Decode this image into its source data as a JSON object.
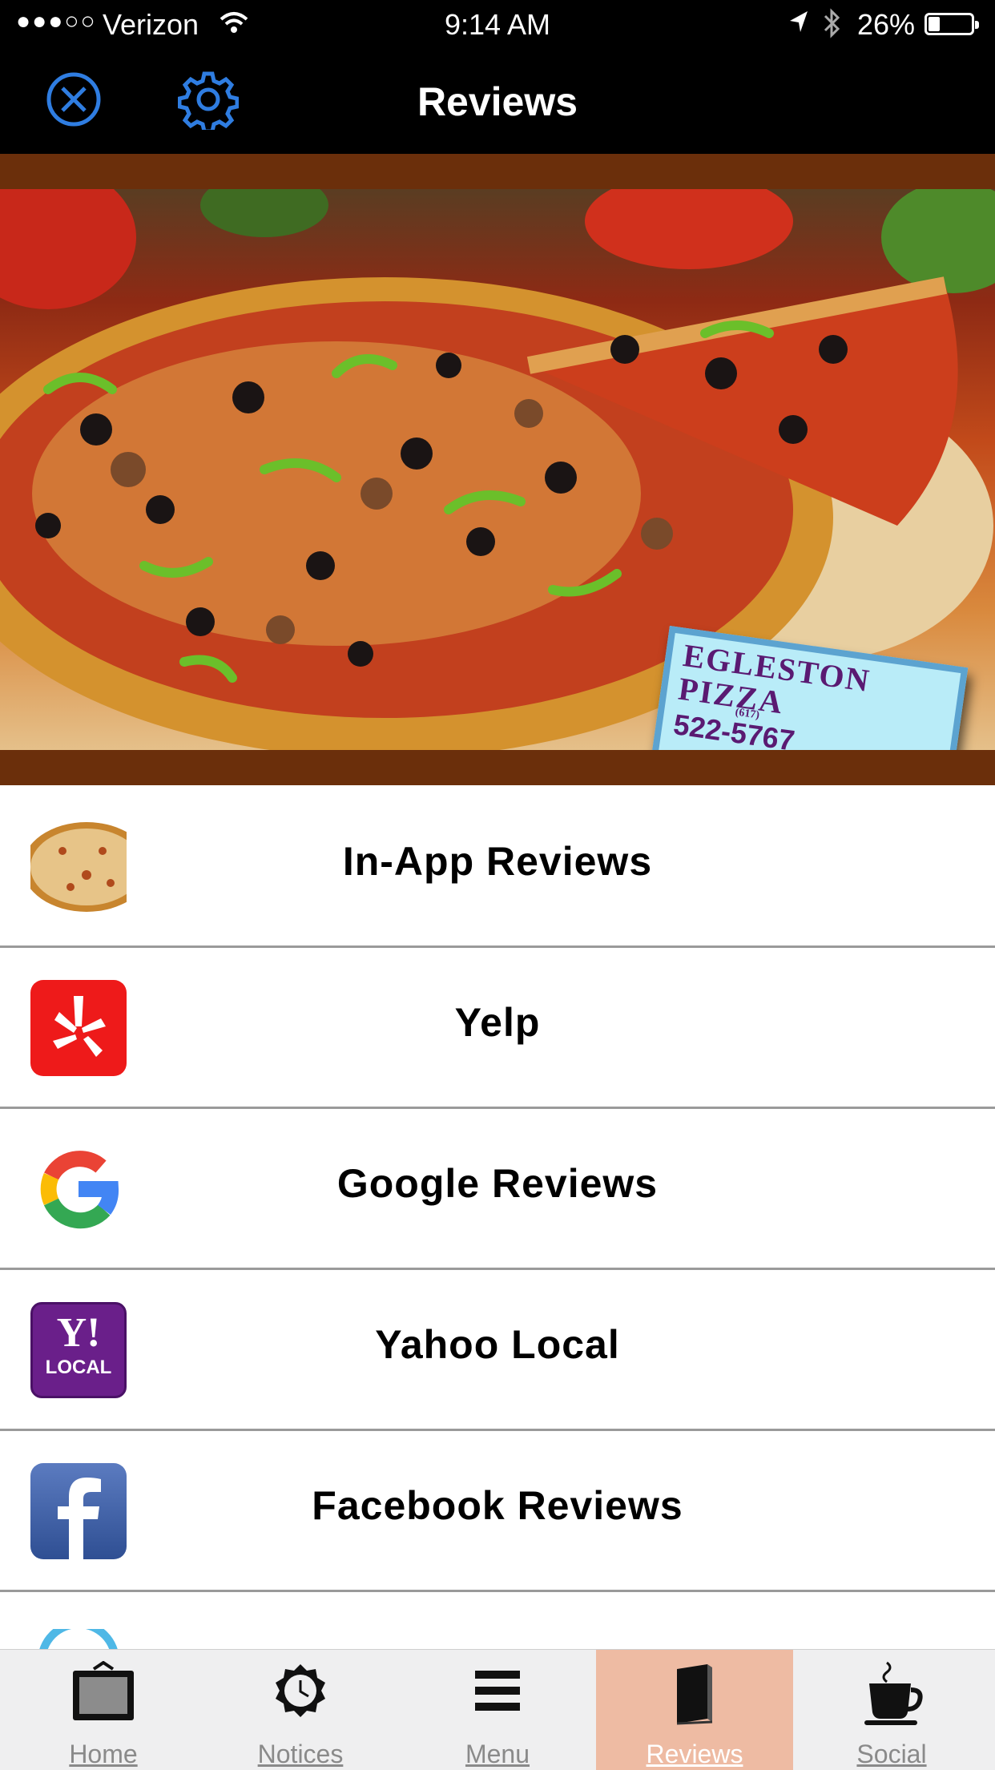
{
  "status_bar": {
    "carrier": "Verizon",
    "signal_dots": "●●●○○",
    "time": "9:14 AM",
    "battery_percent": "26%",
    "battery_level": 0.26
  },
  "nav": {
    "title": "Reviews",
    "close_icon": "close-circle-icon",
    "settings_icon": "gear-icon"
  },
  "hero": {
    "sign_line1": "EGLESTON",
    "sign_line2": "PIZZA",
    "sign_area_code": "(617)",
    "sign_phone": "522-5767"
  },
  "review_sources": [
    {
      "label": "In-App Reviews",
      "icon": "pizza-icon"
    },
    {
      "label": "Yelp",
      "icon": "yelp-icon"
    },
    {
      "label": "Google Reviews",
      "icon": "google-icon"
    },
    {
      "label": "Yahoo Local",
      "icon": "yahoo-local-icon"
    },
    {
      "label": "Facebook Reviews",
      "icon": "facebook-icon"
    }
  ],
  "yahoo_icon_text": {
    "line1": "Y!",
    "line2": "LOCAL"
  },
  "tabs": [
    {
      "label": "Home",
      "icon": "tv-icon",
      "active": false
    },
    {
      "label": "Notices",
      "icon": "clock-badge-icon",
      "active": false
    },
    {
      "label": "Menu",
      "icon": "menu-icon",
      "active": false
    },
    {
      "label": "Reviews",
      "icon": "book-icon",
      "active": true
    },
    {
      "label": "Social",
      "icon": "coffee-cup-icon",
      "active": false
    }
  ],
  "colors": {
    "nav_background": "#000000",
    "nav_icon_blue": "#2f7de1",
    "hero_frame": "#6b2f0b",
    "active_tab": "#eebba3",
    "yelp_red": "#ee1a1a",
    "yahoo_purple": "#6a1f8a",
    "facebook_blue": "#3b5998"
  }
}
